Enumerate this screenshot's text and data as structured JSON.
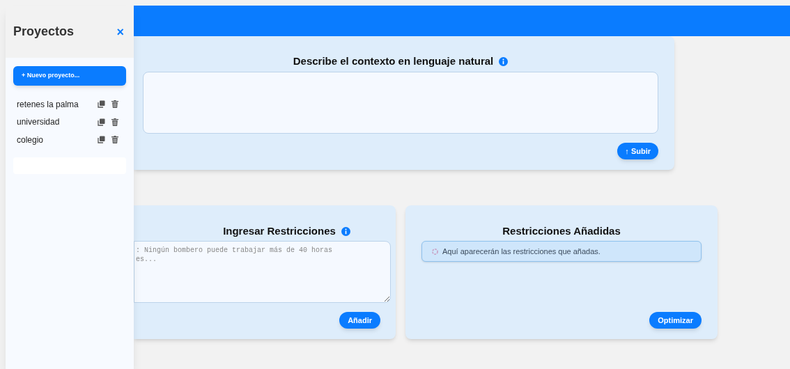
{
  "sidebar": {
    "title": "Proyectos",
    "close": "×",
    "new_button": "+ Nuevo proyecto...",
    "projects": [
      {
        "name": "retenes la palma"
      },
      {
        "name": "universidad"
      },
      {
        "name": "colegio"
      }
    ]
  },
  "context_card": {
    "title": "Describe el contexto en lenguaje natural",
    "button": "↑ Subir"
  },
  "restrictions_card": {
    "title": "Ingresar Restricciones",
    "placeholder": ": Ningún bombero puede trabajar más de 40 horas\nes...",
    "button": "Añadir"
  },
  "added_card": {
    "title": "Restricciones Añadidas",
    "notice": "Aquí aparecerán las restricciones que añadas.",
    "button": "Optimizar"
  }
}
